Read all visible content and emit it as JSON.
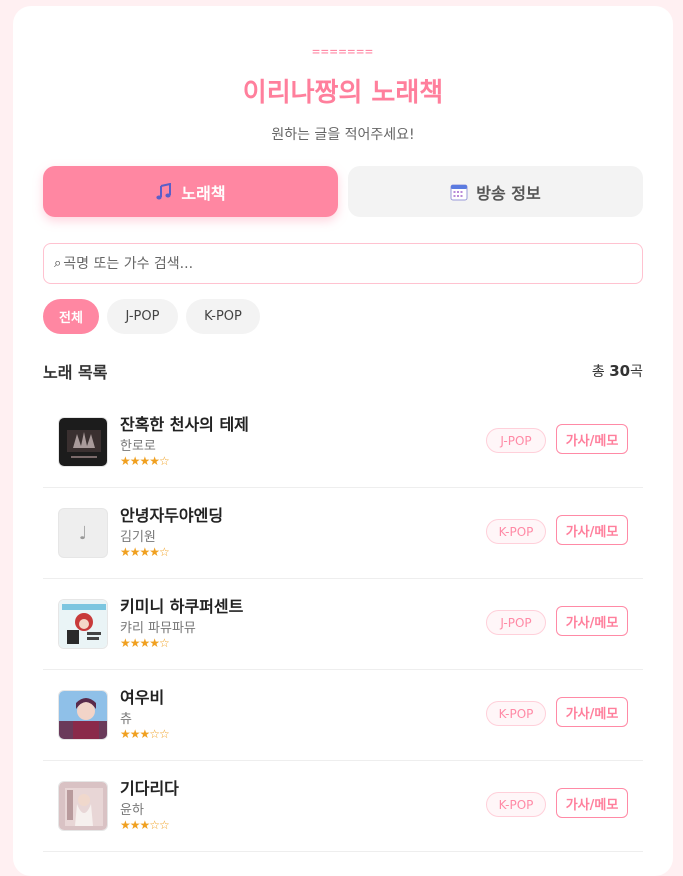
{
  "header": {
    "decoration": "=======",
    "title": "이리나짱의 노래책",
    "subtitle": "원하는 글을 적어주세요!"
  },
  "tabs": [
    {
      "label": "노래책",
      "icon": "music-note-icon",
      "active": true
    },
    {
      "label": "방송 정보",
      "icon": "calendar-icon",
      "active": false
    }
  ],
  "search": {
    "placeholder": "곡명 또는 가수 검색...",
    "value": ""
  },
  "filters": [
    {
      "label": "전체",
      "active": true
    },
    {
      "label": "J-POP",
      "active": false
    },
    {
      "label": "K-POP",
      "active": false
    }
  ],
  "list": {
    "title": "노래 목록",
    "count_prefix": "총 ",
    "count": "30",
    "count_suffix": "곡"
  },
  "songs": [
    {
      "title": "잔혹한 천사의 테제",
      "artist": "한로로",
      "stars": "★★★★☆",
      "genre": "J-POP",
      "button": "가사/메모"
    },
    {
      "title": "안녕자두야엔딩",
      "artist": "김기원",
      "stars": "★★★★☆",
      "genre": "K-POP",
      "button": "가사/메모"
    },
    {
      "title": "키미니 하쿠퍼센트",
      "artist": "캬리 파뮤파뮤",
      "stars": "★★★★☆",
      "genre": "J-POP",
      "button": "가사/메모"
    },
    {
      "title": "여우비",
      "artist": "츄",
      "stars": "★★★☆☆",
      "genre": "K-POP",
      "button": "가사/메모"
    },
    {
      "title": "기다리다",
      "artist": "윤하",
      "stars": "★★★☆☆",
      "genre": "K-POP",
      "button": "가사/메모"
    }
  ],
  "colors": {
    "accent": "#ff87a2",
    "star": "#f0a020"
  }
}
